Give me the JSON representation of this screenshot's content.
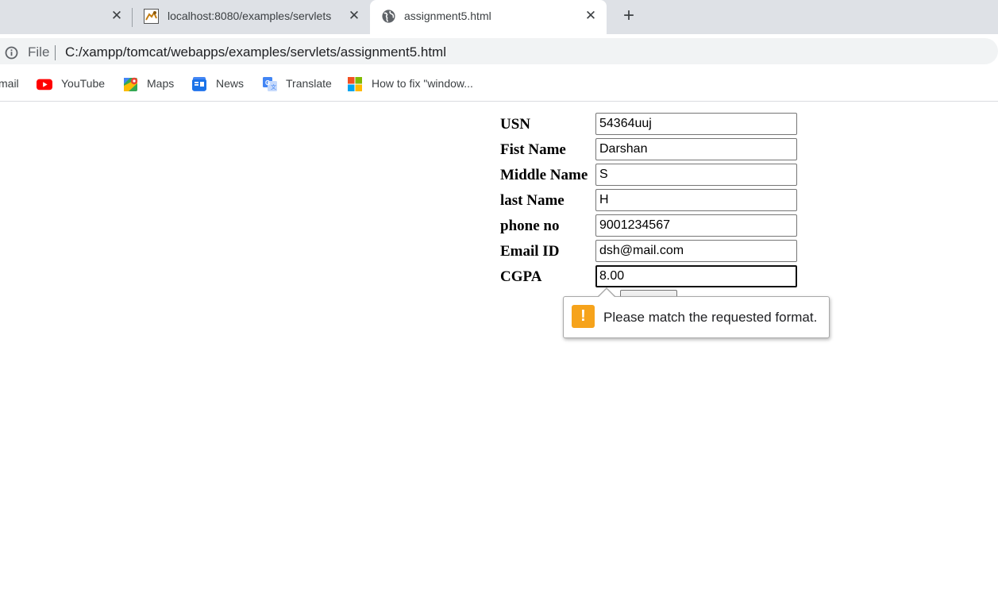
{
  "browser": {
    "tabs": [
      {
        "title": "",
        "favicon": "none"
      },
      {
        "title": "localhost:8080/examples/servlets",
        "favicon": "tomcat-icon"
      },
      {
        "title": "assignment5.html",
        "favicon": "globe-icon"
      }
    ],
    "new_tab_glyph": "+",
    "close_glyph": "✕",
    "address": {
      "scheme": "File",
      "url": "C:/xampp/tomcat/webapps/examples/servlets/assignment5.html"
    },
    "bookmarks": [
      {
        "label": "mail",
        "icon": "gmail-icon"
      },
      {
        "label": "YouTube",
        "icon": "youtube-icon"
      },
      {
        "label": "Maps",
        "icon": "maps-icon"
      },
      {
        "label": "News",
        "icon": "news-icon"
      },
      {
        "label": "Translate",
        "icon": "translate-icon"
      },
      {
        "label": "How to fix \"window...",
        "icon": "windows-icon"
      }
    ]
  },
  "form": {
    "fields": [
      {
        "label": "USN",
        "value": "54364uuj"
      },
      {
        "label": "Fist Name",
        "value": "Darshan"
      },
      {
        "label": "Middle Name",
        "value": "S"
      },
      {
        "label": "last Name",
        "value": "H"
      },
      {
        "label": "phone no",
        "value": "9001234567"
      },
      {
        "label": "Email ID",
        "value": "dsh@mail.com"
      },
      {
        "label": "CGPA",
        "value": "8.00"
      }
    ]
  },
  "validation": {
    "message": "Please match the requested format.",
    "icon": "warning-icon",
    "icon_glyph": "!",
    "color": "#f6a31b"
  },
  "colors": {
    "tabstrip": "#dee1e6",
    "omnibox": "#f1f3f4",
    "youtube_red": "#ff0000"
  }
}
